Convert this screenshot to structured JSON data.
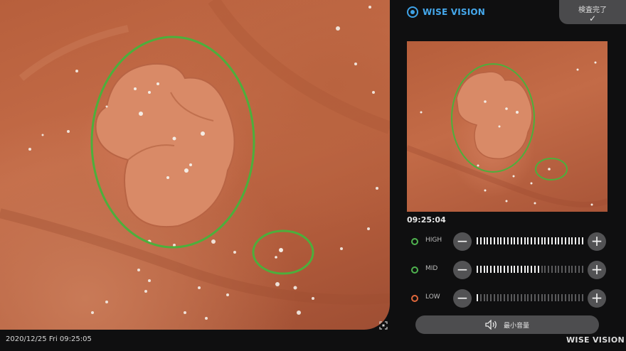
{
  "header": {
    "logo_text": "WISE VISION",
    "done_button_label": "検査完了",
    "done_check_glyph": "✓"
  },
  "thumbnail": {
    "timestamp": "09:25:04"
  },
  "sensitivity": {
    "levels": [
      {
        "label": "HIGH",
        "dot_color": "#4fb34f",
        "level_fraction": 1.0
      },
      {
        "label": "MID",
        "dot_color": "#4fb34f",
        "level_fraction": 0.6
      },
      {
        "label": "LOW",
        "dot_color": "#e0683c",
        "level_fraction": 0.03
      }
    ],
    "minus_glyph": "−",
    "plus_glyph": "+"
  },
  "volume": {
    "label": "最小音量",
    "icon": "speaker-icon"
  },
  "status_bar": {
    "datetime": "2020/12/25 Fri 09:25:05",
    "brand": "WISE VISION"
  },
  "colors": {
    "accent": "#45a8ec",
    "detection_ring": "#4caf3c"
  }
}
